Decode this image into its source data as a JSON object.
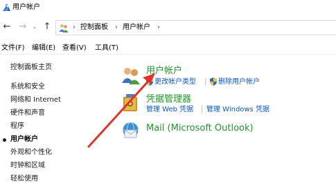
{
  "window": {
    "title": "用户帐户"
  },
  "address": {
    "crumbs": [
      "控制面板",
      "用户帐户"
    ],
    "separators": [
      "›",
      "›",
      "›"
    ]
  },
  "nav": {
    "back": "←",
    "forward": "→",
    "recent": "⌄",
    "up": "↑"
  },
  "menu": [
    {
      "label": "文件(F)"
    },
    {
      "label": "编辑(E)"
    },
    {
      "label": "查看(V)"
    },
    {
      "label": "工具(T)"
    }
  ],
  "sidebar": {
    "items": [
      {
        "label": "控制面板主页"
      },
      {
        "label": "系统和安全"
      },
      {
        "label": "网络和 Internet"
      },
      {
        "label": "硬件和声音"
      },
      {
        "label": "程序"
      },
      {
        "label": "用户帐户",
        "current": true
      },
      {
        "label": "外观和个性化"
      },
      {
        "label": "时钟和区域"
      },
      {
        "label": "轻松使用"
      }
    ]
  },
  "main": {
    "categories": [
      {
        "title": "用户帐户",
        "icon": "users-icon",
        "tasks": [
          {
            "label": "更改帐户类型",
            "shield": true
          },
          {
            "label": "删除用户帐户",
            "shield": true
          }
        ]
      },
      {
        "title": "凭据管理器",
        "icon": "credential-vault-icon",
        "tasks": [
          {
            "label": "管理 Web 凭据"
          },
          {
            "label": "管理 Windows 凭据"
          }
        ]
      },
      {
        "title": "Mail (Microsoft Outlook)",
        "icon": "mail-icon",
        "tasks": []
      }
    ]
  },
  "colors": {
    "link": "#0b57c9",
    "category_title": "#1e9928",
    "annotation_arrow": "#e0312b"
  }
}
